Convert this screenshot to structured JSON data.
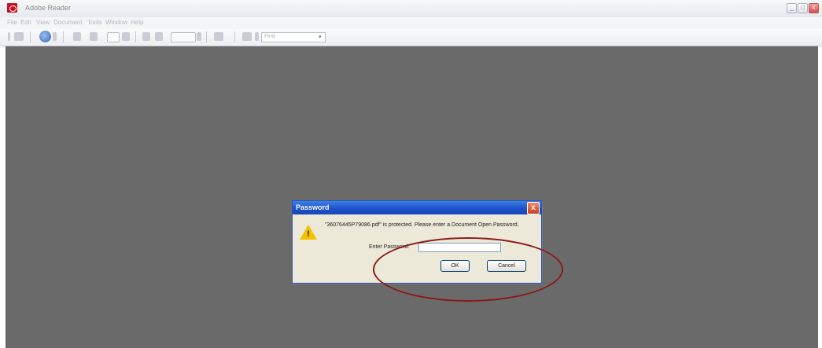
{
  "window": {
    "title": "Adobe Reader",
    "buttons": {
      "minimize": "_",
      "maximize": "□",
      "close": "x"
    }
  },
  "menu": [
    "File",
    "Edit",
    "View",
    "Document",
    "Tools",
    "Window",
    "Help"
  ],
  "toolbar": {
    "find_placeholder": "Find"
  },
  "dialog": {
    "title": "Password",
    "message": "\"36076445P79086.pdf\" is protected. Please enter a Document Open Password.",
    "password_label": "Enter Password:",
    "password_value": "",
    "ok_label": "OK",
    "cancel_label": "Cancel",
    "close_glyph": "x",
    "icon": "warning-icon"
  },
  "colors": {
    "doc_background": "#6a6a6a",
    "dialog_title": "#1c4fc9",
    "annotation": "#8b1a1a"
  }
}
